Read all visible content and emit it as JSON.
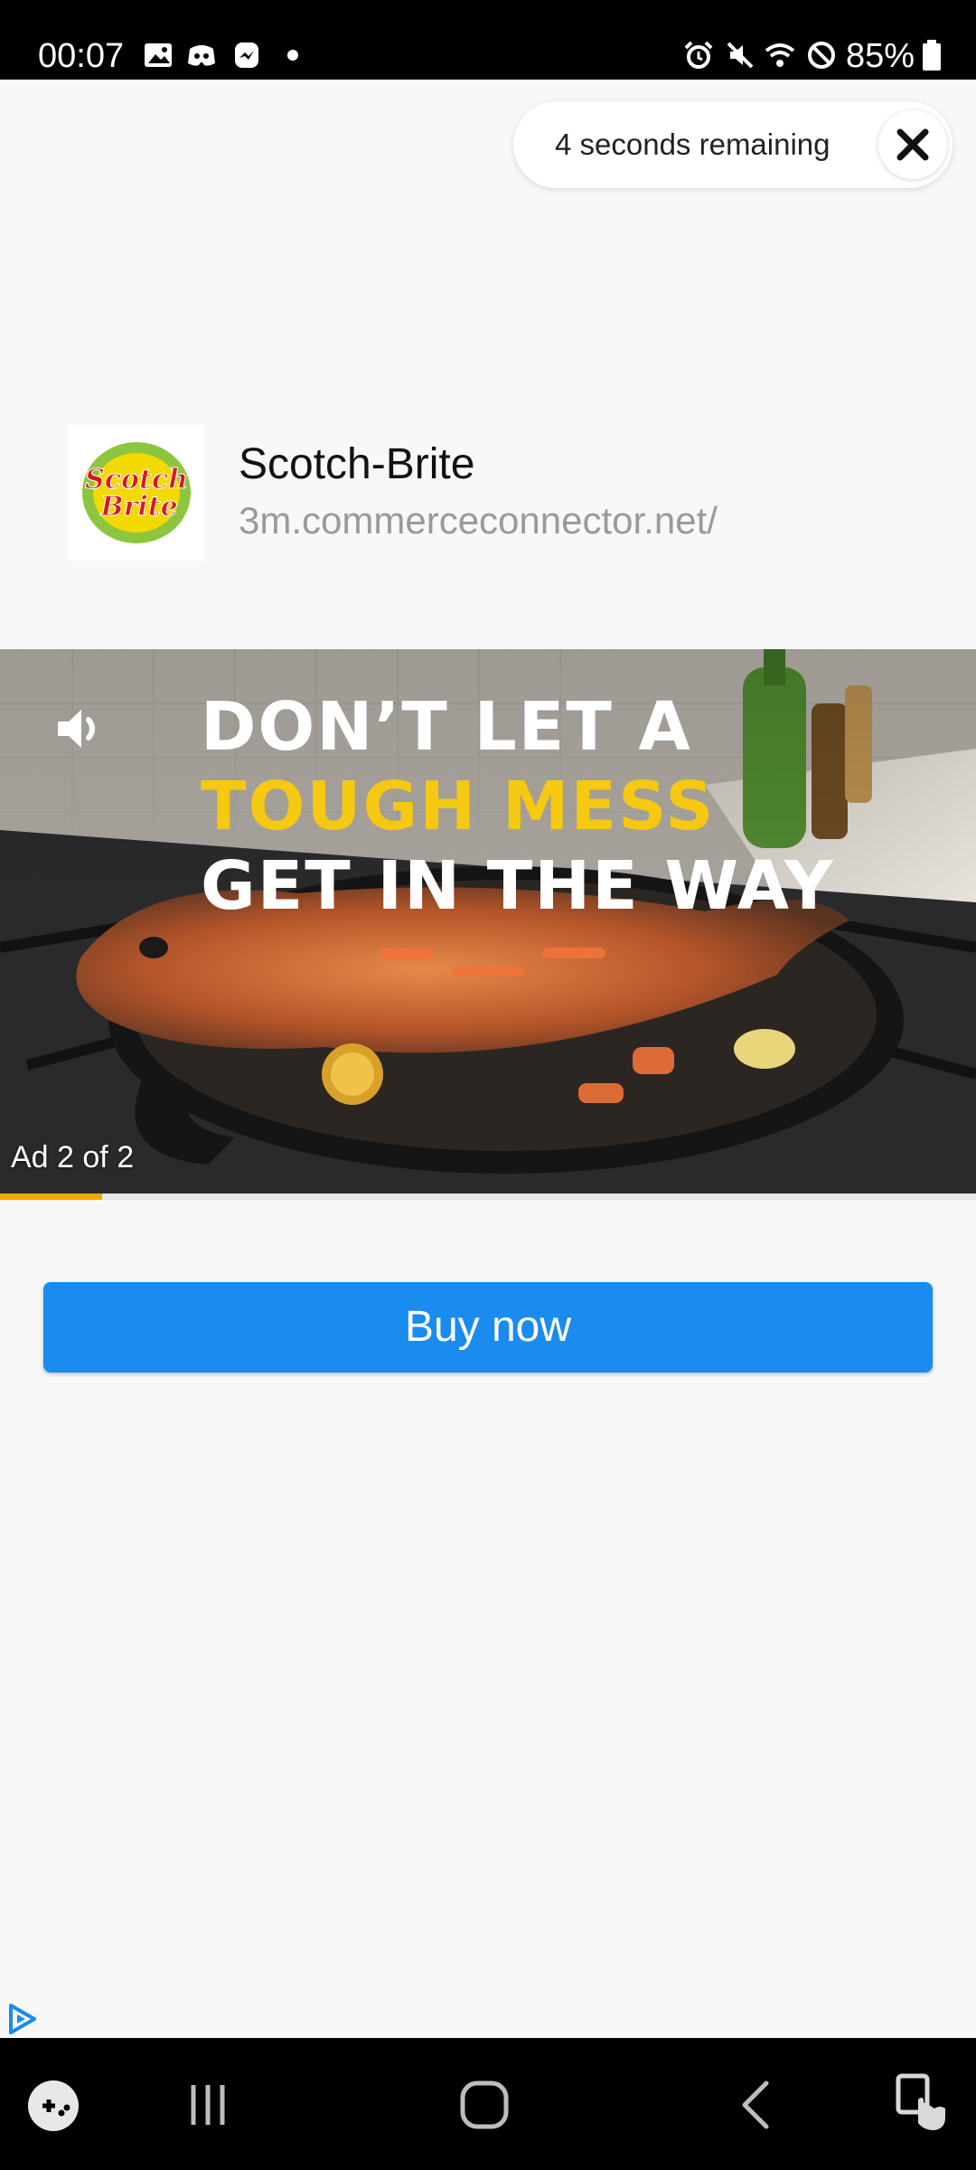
{
  "status_bar": {
    "time": "00:07",
    "battery": "85%",
    "icons": [
      "gallery-icon",
      "discord-icon",
      "messenger-icon",
      "dot-icon",
      "alarm-icon",
      "mute-icon",
      "wifi-icon",
      "do-not-disturb-icon",
      "battery-icon"
    ]
  },
  "ad": {
    "countdown_text": "4 seconds remaining",
    "advertiser": {
      "name": "Scotch-Brite",
      "url": "3m.commerceconnector.net/",
      "logo_line1": "Scotch",
      "logo_line2": "Brite"
    },
    "video": {
      "headline_line1": "DON’T LET A",
      "headline_line2": "TOUGH MESS",
      "headline_line3": "GET IN THE WAY",
      "counter": "Ad 2 of 2",
      "progress": 0.105
    },
    "cta_label": "Buy now"
  },
  "colors": {
    "accent": "#1a8bef",
    "progress": "#f5a800",
    "headline_yellow": "#f5c812"
  },
  "nav_bar": {
    "icons": [
      "game-launcher-icon",
      "recent-apps-icon",
      "home-icon",
      "back-icon",
      "accessibility-icon"
    ]
  }
}
